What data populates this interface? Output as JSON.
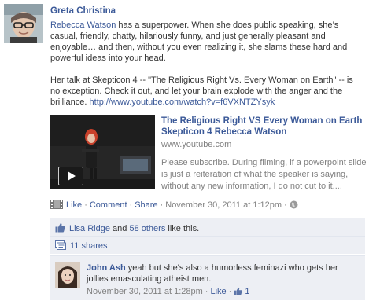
{
  "post": {
    "author": "Greta Christina",
    "mention": "Rebecca Watson",
    "text1_rest": " has a superpower. When she does public speaking, she’s casual, friendly, chatty, hilariously funny, and just generally pleasant and enjoyable… and then, without you even realizing it, she slams these hard and powerful ideas into your head.",
    "text2": "Her talk at Skepticon 4 -- \"The Religious Right Vs. Every Woman on Earth\" -- is no exception. Check it out, and let your brain explode with the anger and the brilliance. ",
    "url": "http://www.youtube.com/watch?v=f6VXNTZYsyk"
  },
  "attachment": {
    "title": "The Religious Right VS Every Woman on Earth Skepticon 4 Rebecca Watson",
    "domain": "www.youtube.com",
    "description": "Please subscribe. During filming, if a powerpoint slide is just a reiteration of what the speaker is saying, without any new information, I do not cut to it....",
    "play_icon": "play-icon"
  },
  "actions": {
    "like": "Like",
    "comment": "Comment",
    "share": "Share",
    "timestamp": "November 30, 2011 at 1:12pm",
    "separator": "·"
  },
  "likes": {
    "user": "Lisa Ridge",
    "and": " and ",
    "others": "58 others",
    "suffix": " like this."
  },
  "shares": {
    "label": "11 shares"
  },
  "comment": {
    "author": "John Ash",
    "text": " yeah but she's also a humorless feminazi who gets her jollies emasculating atheist men.",
    "timestamp": "November 30, 2011 at 1:28pm",
    "like": "Like",
    "like_count": "1"
  },
  "colors": {
    "link": "#3b5998",
    "ufi_bg": "#edeff4",
    "meta": "#808080"
  }
}
